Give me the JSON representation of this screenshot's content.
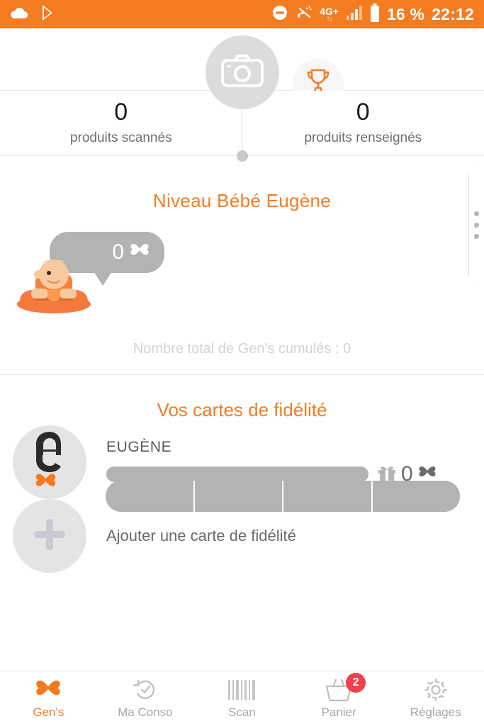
{
  "statusbar": {
    "icons_left": [
      "cloud-icon",
      "google-play-icon"
    ],
    "icons_right": [
      "do-not-disturb-icon",
      "call-muted-icon",
      "network-4gplus-icon",
      "signal-bars-icon",
      "battery-icon"
    ],
    "network_label": "4G+",
    "network_arrows": "↑↓",
    "battery_percent": "16 %",
    "clock": "22:12",
    "background_color": "#F47C20"
  },
  "header": {
    "camera_button_name": "camera-icon",
    "trophy_button_name": "trophy-icon"
  },
  "stats": [
    {
      "value": "0",
      "label": "produits scannés"
    },
    {
      "value": "0",
      "label": "produits renseignés"
    }
  ],
  "level": {
    "title": "Niveau Bébé Eugène",
    "bubble_value": "0",
    "bubble_unit_icon": "gens-bowtie-icon",
    "segments_total": 4,
    "segments_filled": 0,
    "cumul_text": "Nombre total de Gen's cumulés : 0",
    "drawer_handle_name": "side-drawer-handle"
  },
  "fidelity": {
    "title": "Vos cartes de fidélité",
    "cards": [
      {
        "name": "EUGÈNE",
        "logo_icon": "eugene-logo-icon",
        "progress_percent": 0,
        "gift_icon": "gift-icon",
        "points": "0",
        "points_unit_icon": "gens-bowtie-icon"
      }
    ],
    "add_card": {
      "icon": "plus-icon",
      "label": "Ajouter une carte de fidélité"
    }
  },
  "bottom_nav": {
    "items": [
      {
        "label": "Gen's",
        "icon": "gens-bowtie-icon",
        "active": true,
        "badge": ""
      },
      {
        "label": "Ma Conso",
        "icon": "history-check-icon",
        "active": false,
        "badge": ""
      },
      {
        "label": "Scan",
        "icon": "barcode-icon",
        "active": false,
        "badge": ""
      },
      {
        "label": "Panier",
        "icon": "basket-icon",
        "active": false,
        "badge": "2"
      },
      {
        "label": "Règlages",
        "icon": "gear-icon",
        "active": false,
        "badge": ""
      }
    ]
  },
  "colors": {
    "brand_orange": "#F47C20",
    "gray": "#b3b3b3",
    "badge_red": "#f0404a"
  }
}
